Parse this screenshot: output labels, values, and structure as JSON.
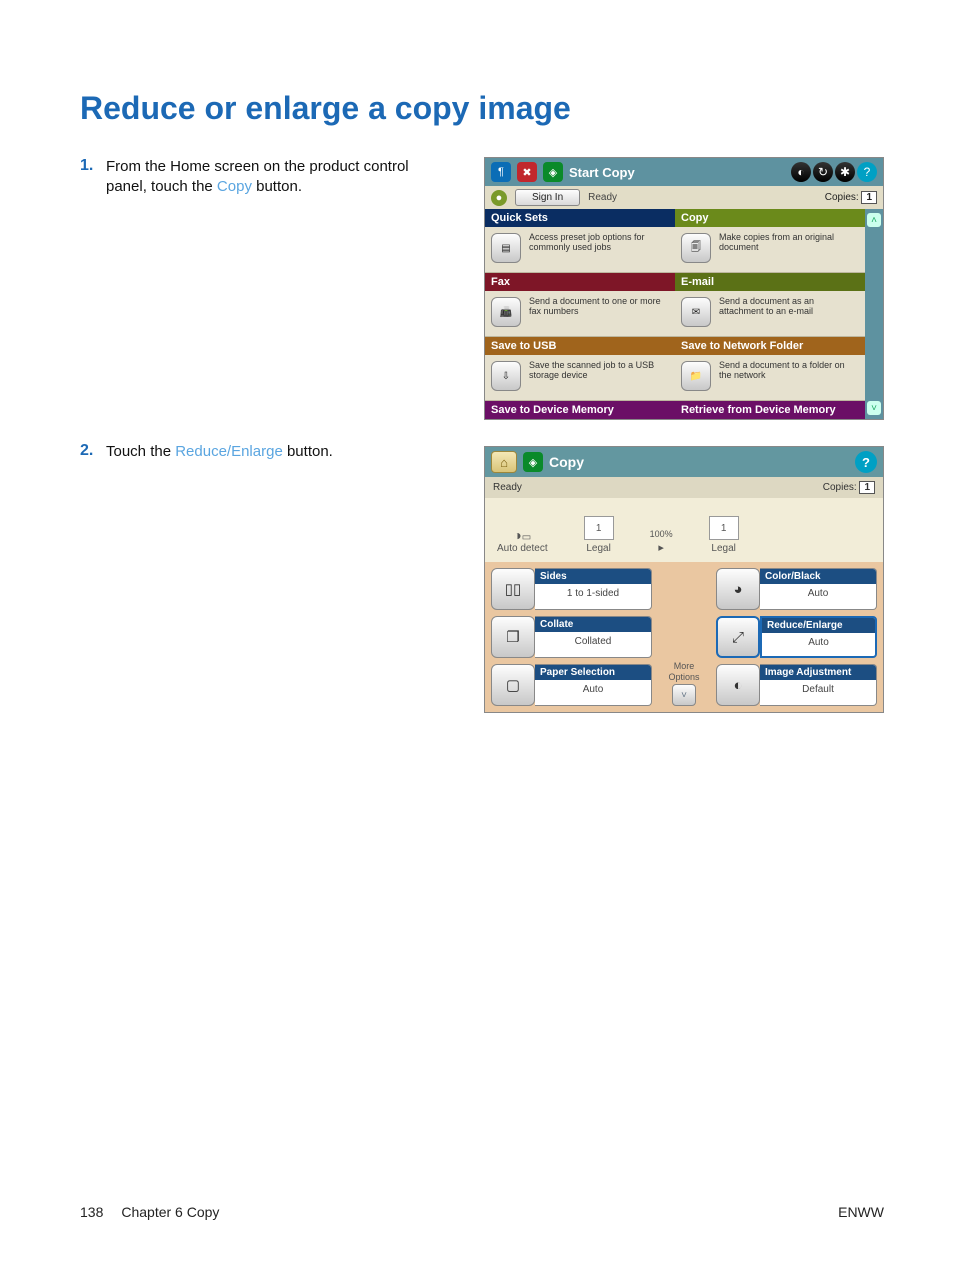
{
  "page": {
    "title": "Reduce or enlarge a copy image",
    "number": "138",
    "chapter": "Chapter 6   Copy",
    "region": "ENWW"
  },
  "steps": {
    "s1_num": "1.",
    "s1_a": "From the Home screen on the product control panel, touch the ",
    "s1_link": "Copy",
    "s1_b": " button.",
    "s2_num": "2.",
    "s2_a": "Touch the ",
    "s2_link": "Reduce/Enlarge",
    "s2_b": " button."
  },
  "shot1": {
    "title": "Start Copy",
    "signin": "Sign In",
    "ready": "Ready",
    "copies_lbl": "Copies:",
    "copies_val": "1",
    "h_quicksets": "Quick Sets",
    "d_quicksets": "Access preset job options for commonly used jobs",
    "h_copy": "Copy",
    "d_copy": "Make copies from an original document",
    "h_fax": "Fax",
    "d_fax": "Send a document to one or more fax numbers",
    "h_email": "E-mail",
    "d_email": "Send a document as an attachment to an e-mail",
    "h_usb": "Save to USB",
    "d_usb": "Save the scanned job to a USB storage device",
    "h_net": "Save to Network Folder",
    "d_net": "Send a document to a folder on the network",
    "h_dev": "Save to Device Memory",
    "h_ret": "Retrieve from Device Memory"
  },
  "shot2": {
    "title": "Copy",
    "ready": "Ready",
    "copies_lbl": "Copies:",
    "copies_val": "1",
    "autodetect": "Auto detect",
    "pct": "100%",
    "one": "1",
    "legal": "Legal",
    "more": "More",
    "options": "Options",
    "sides_h": "Sides",
    "sides_v": "1 to 1-sided",
    "collate_h": "Collate",
    "collate_v": "Collated",
    "paper_h": "Paper Selection",
    "paper_v": "Auto",
    "color_h": "Color/Black",
    "color_v": "Auto",
    "reduce_h": "Reduce/Enlarge",
    "reduce_v": "Auto",
    "image_h": "Image Adjustment",
    "image_v": "Default"
  }
}
